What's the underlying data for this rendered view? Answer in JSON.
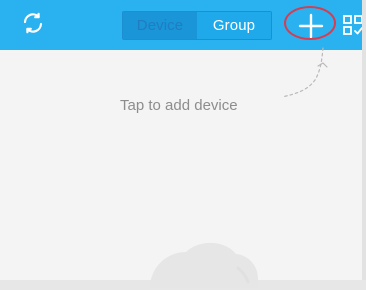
{
  "header": {
    "refresh_icon": "refresh-icon",
    "tabs": [
      {
        "label": "Device",
        "selected": true
      },
      {
        "label": "Group",
        "selected": false
      }
    ],
    "add_icon": "plus-icon",
    "qr_icon": "qr-check-icon"
  },
  "content": {
    "hint": "Tap to add device"
  },
  "colors": {
    "header_bg": "#29b1f0",
    "selected_tab_bg": "#1995d8",
    "highlight": "#d83c4e",
    "hint_text": "#8d8d8d",
    "content_bg": "#f4f4f4"
  }
}
